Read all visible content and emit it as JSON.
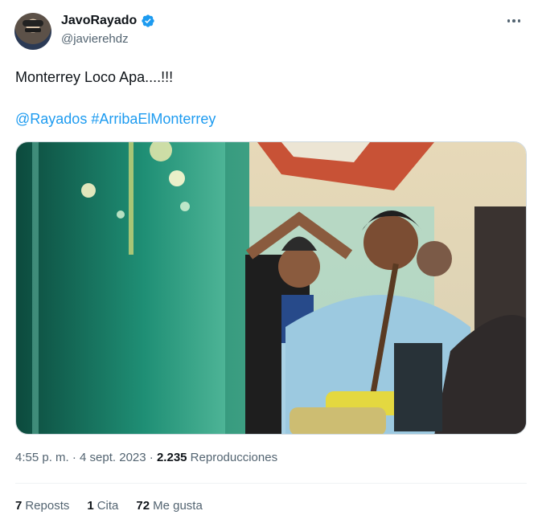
{
  "author": {
    "display_name": "JavoRayado",
    "handle": "@javierehdz",
    "verified": true
  },
  "tweet": {
    "text_line1": "Monterrey Loco Apa....!!!",
    "mention": "@Rayados",
    "hashtag": "#ArribaElMonterrey"
  },
  "meta": {
    "time": "4:55 p. m.",
    "separator1": " · ",
    "date": "4 sept. 2023",
    "separator2": " · ",
    "views_count": "2.235",
    "views_label": " Reproducciones"
  },
  "stats": [
    {
      "count": "7",
      "label": "Reposts"
    },
    {
      "count": "1",
      "label": "Cita"
    },
    {
      "count": "72",
      "label": "Me gusta"
    }
  ],
  "colors": {
    "link": "#1d9bf0",
    "verified_badge": "#1d9bf0",
    "secondary_text": "#536471"
  },
  "icons": {
    "verified": "verified-badge-icon",
    "more": "more-options-icon"
  }
}
